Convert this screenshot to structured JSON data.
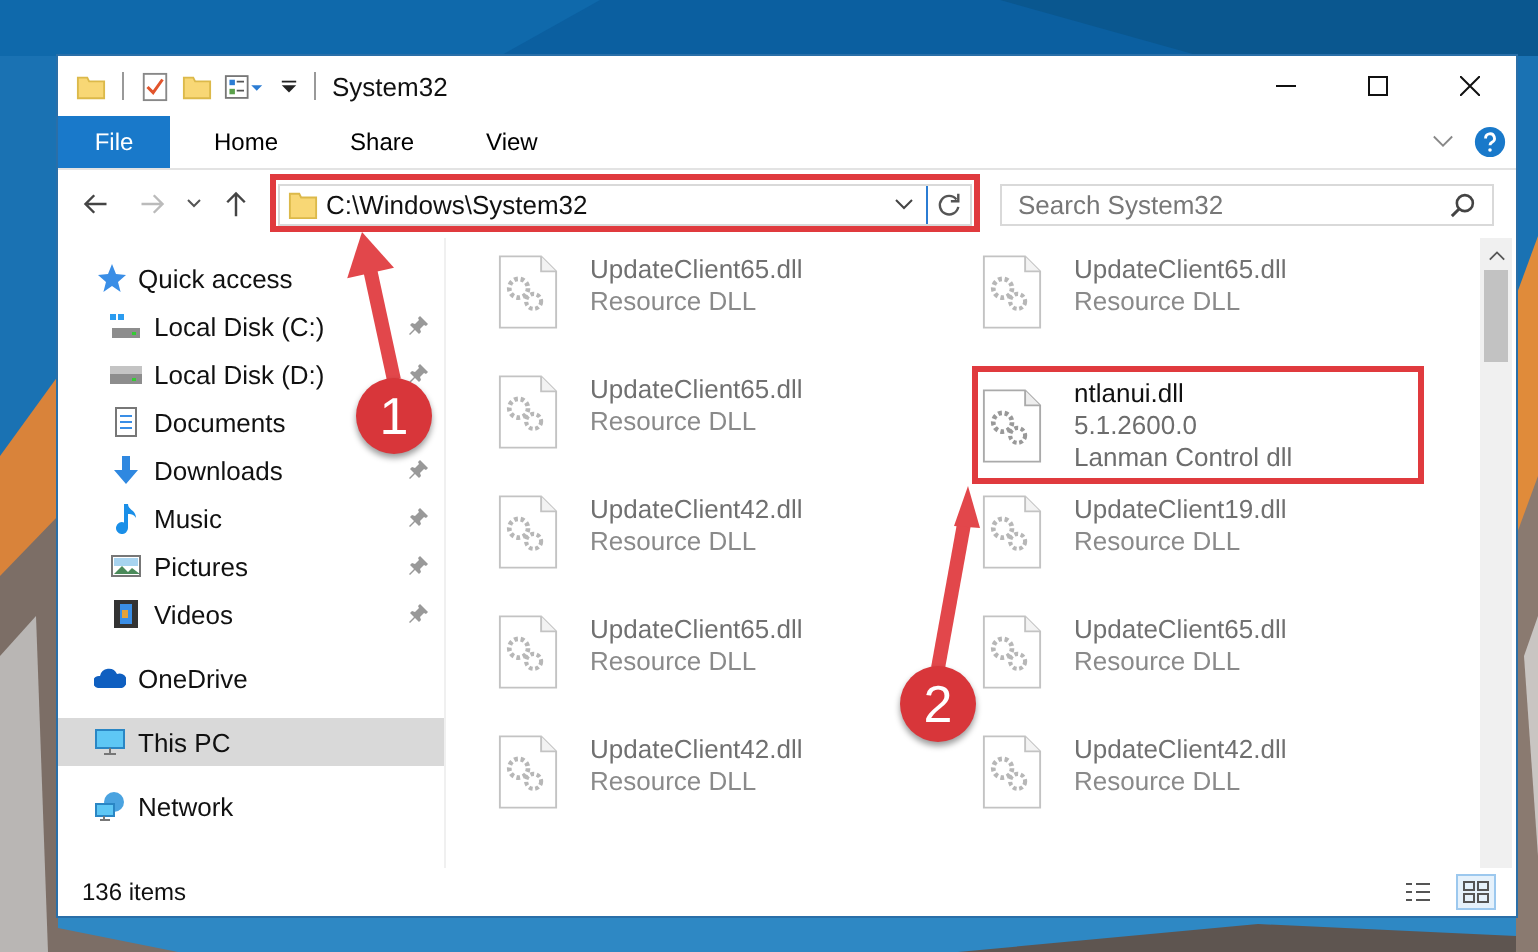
{
  "window": {
    "title": "System32"
  },
  "ribbon_tabs": [
    {
      "label": "File",
      "kind": "file"
    },
    {
      "label": "Home",
      "kind": "tab"
    },
    {
      "label": "Share",
      "kind": "tab"
    },
    {
      "label": "View",
      "kind": "tab"
    }
  ],
  "address": {
    "path": "C:\\Windows\\System32"
  },
  "search": {
    "placeholder": "Search System32"
  },
  "sidebar": {
    "items": [
      {
        "label": "Quick access",
        "selected": false,
        "children": [
          {
            "label": "Local Disk (C:)",
            "pinned": true,
            "selected": false
          },
          {
            "label": "Local Disk (D:)",
            "pinned": true,
            "selected": false
          },
          {
            "label": "Documents",
            "selected": false
          },
          {
            "label": "Downloads",
            "pinned": true,
            "selected": false
          },
          {
            "label": "Music",
            "pinned": true,
            "selected": false
          },
          {
            "label": "Pictures",
            "pinned": true,
            "selected": false
          },
          {
            "label": "Videos",
            "pinned": true,
            "selected": false
          }
        ]
      },
      {
        "label": "OneDrive",
        "selected": false
      },
      {
        "label": "This PC",
        "selected": true
      },
      {
        "label": "Network",
        "selected": false
      }
    ]
  },
  "files": [
    {
      "name": "UpdateClient65.dll",
      "lines": [
        "Resource DLL"
      ],
      "blurred": true
    },
    {
      "name": "UpdateClient65.dll",
      "lines": [
        "Resource DLL"
      ],
      "blurred": true
    },
    {
      "name": "UpdateClient65.dll",
      "lines": [
        "Resource DLL"
      ],
      "blurred": true
    },
    {
      "name": "ntlanui.dll",
      "lines": [
        "5.1.2600.0",
        "Lanman Control dll"
      ],
      "blurred": false
    },
    {
      "name": "UpdateClient42.dll",
      "lines": [
        "Resource DLL"
      ],
      "blurred": true
    },
    {
      "name": "UpdateClient19.dll",
      "lines": [
        "Resource DLL"
      ],
      "blurred": true
    },
    {
      "name": "UpdateClient65.dll",
      "lines": [
        "Resource DLL"
      ],
      "blurred": true
    },
    {
      "name": "UpdateClient65.dll",
      "lines": [
        "Resource DLL"
      ],
      "blurred": true
    },
    {
      "name": "UpdateClient42.dll",
      "lines": [
        "Resource DLL"
      ],
      "blurred": true
    },
    {
      "name": "UpdateClient42.dll",
      "lines": [
        "Resource DLL"
      ],
      "blurred": true
    }
  ],
  "status_bar": {
    "item_count": "136 items"
  },
  "annotations": [
    {
      "label": "1"
    },
    {
      "label": "2"
    }
  ]
}
